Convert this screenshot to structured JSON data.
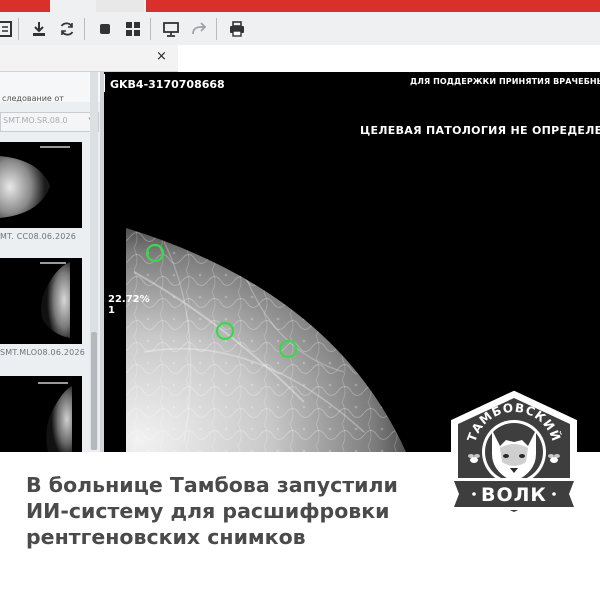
{
  "toolbar": {
    "icons": [
      "document-icon",
      "download-icon",
      "refresh-icon",
      "stop-icon",
      "grid-layout-icon",
      "monitor-icon",
      "redo-icon",
      "print-icon"
    ]
  },
  "tab": {
    "close_label": "×"
  },
  "sidebar": {
    "study_label": "следование от",
    "series_select_value": "SMT.MO.SR.08.0",
    "thumbnails": [
      {
        "label": "MT. CC08.06.2026"
      },
      {
        "label": "SMT.MLO08.06.2026"
      },
      {
        "label": ""
      }
    ]
  },
  "viewer": {
    "study_id": "GKB4-3170708668",
    "support_text": "ДЛЯ ПОДДЕРЖКИ ПРИНЯТИЯ ВРАЧЕБНЫ",
    "pathology_text": "ЦЕЛЕВАЯ ПАТОЛОГИЯ НЕ ОПРЕДЕЛЕ",
    "score_value": "22.72%",
    "score_index": "1",
    "finding_color": "#39d94a"
  },
  "caption": {
    "headline": "В больнице Тамбова запустили ИИ-систему для расшифровки рентгеновских снимков"
  },
  "logo": {
    "top_text": "ТАМБОВСКИЙ",
    "bottom_text": "ВОЛК",
    "badge_color": "#3e3e3e"
  },
  "colors": {
    "accent_red": "#d9302b",
    "viewer_bg": "#000000",
    "headline_text": "#4a4a4a"
  }
}
